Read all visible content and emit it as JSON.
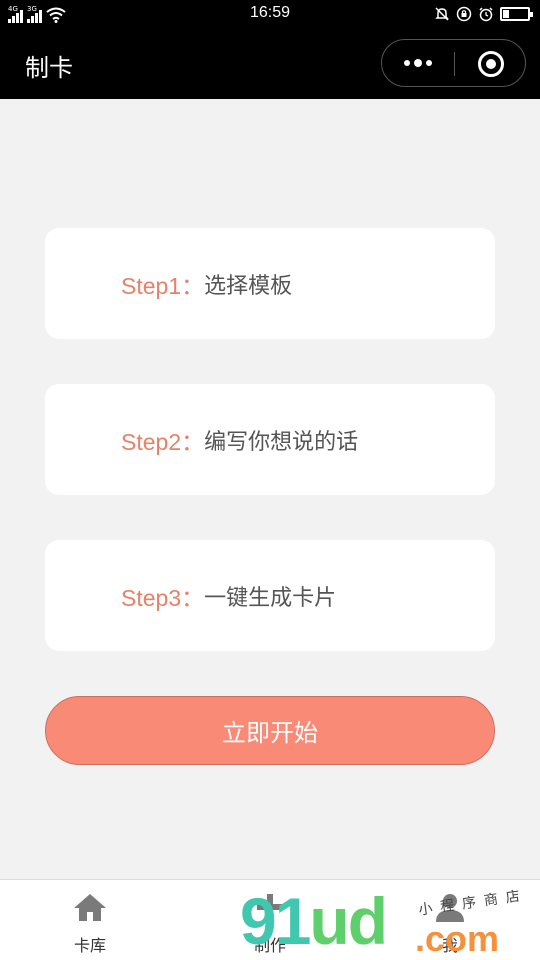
{
  "status_bar": {
    "network1": "4G",
    "network2": "3G",
    "time": "16:59",
    "battery_level": 0.25
  },
  "nav": {
    "title": "制卡"
  },
  "steps": [
    {
      "label": "Step1：",
      "text": "选择模板"
    },
    {
      "label": "Step2：",
      "text": "编写你想说的话"
    },
    {
      "label": "Step3：",
      "text": "一键生成卡片"
    }
  ],
  "start_button": {
    "label": "立即开始"
  },
  "tabbar": {
    "items": [
      {
        "label": "卡库",
        "icon": "home-icon"
      },
      {
        "label": "制作",
        "icon": "plus-icon"
      },
      {
        "label": "我",
        "icon": "user-icon"
      }
    ]
  },
  "watermark": {
    "big": "91ud",
    "small": "小程序商店",
    "com": ".com"
  },
  "colors": {
    "accent": "#f98b76",
    "step_label": "#e5826a",
    "background": "#f2f2f2"
  }
}
